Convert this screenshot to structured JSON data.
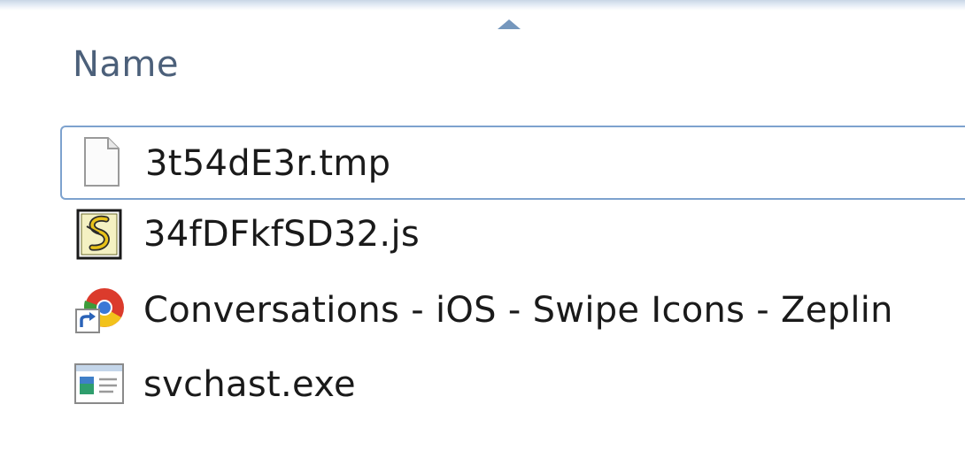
{
  "columns": {
    "name_label": "Name",
    "sort_direction": "ascending"
  },
  "files": [
    {
      "name": "3t54dE3r.tmp",
      "icon": "generic-file-icon",
      "focused": true
    },
    {
      "name": "34fDFkfSD32.js",
      "icon": "script-file-icon",
      "focused": false
    },
    {
      "name": "Conversations - iOS - Swipe Icons - Zeplin",
      "icon": "chrome-shortcut-icon",
      "focused": false
    },
    {
      "name": "svchast.exe",
      "icon": "application-exe-icon",
      "focused": false
    }
  ],
  "colors": {
    "header_text": "#4c607a",
    "focus_border": "#7da2ce",
    "sort_arrow": "#5d85b1"
  }
}
